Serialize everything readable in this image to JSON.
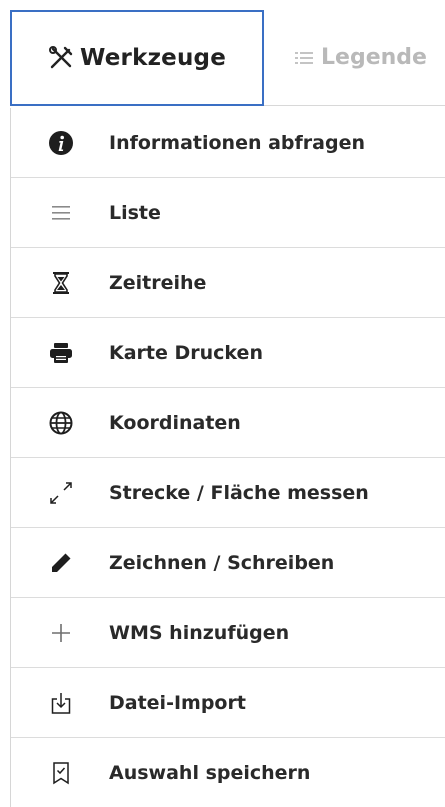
{
  "tabs": [
    {
      "label": "Werkzeuge",
      "icon": "tools-icon",
      "active": true
    },
    {
      "label": "Legende",
      "icon": "list-icon",
      "active": false
    }
  ],
  "menu": {
    "items": [
      {
        "label": "Informationen abfragen",
        "icon": "info-icon"
      },
      {
        "label": "Liste",
        "icon": "list-lines-icon"
      },
      {
        "label": "Zeitreihe",
        "icon": "hourglass-icon"
      },
      {
        "label": "Karte Drucken",
        "icon": "printer-icon"
      },
      {
        "label": "Koordinaten",
        "icon": "globe-icon"
      },
      {
        "label": "Strecke / Fläche messen",
        "icon": "measure-arrows-icon"
      },
      {
        "label": "Zeichnen / Schreiben",
        "icon": "pencil-icon"
      },
      {
        "label": "WMS hinzufügen",
        "icon": "plus-icon"
      },
      {
        "label": "Datei-Import",
        "icon": "file-import-icon"
      },
      {
        "label": "Auswahl speichern",
        "icon": "bookmark-check-icon"
      }
    ]
  },
  "colors": {
    "active_border": "#3a6fc4",
    "text": "#2a2a2a",
    "inactive_text": "#b9b9b9",
    "divider": "#dcdcdc"
  }
}
